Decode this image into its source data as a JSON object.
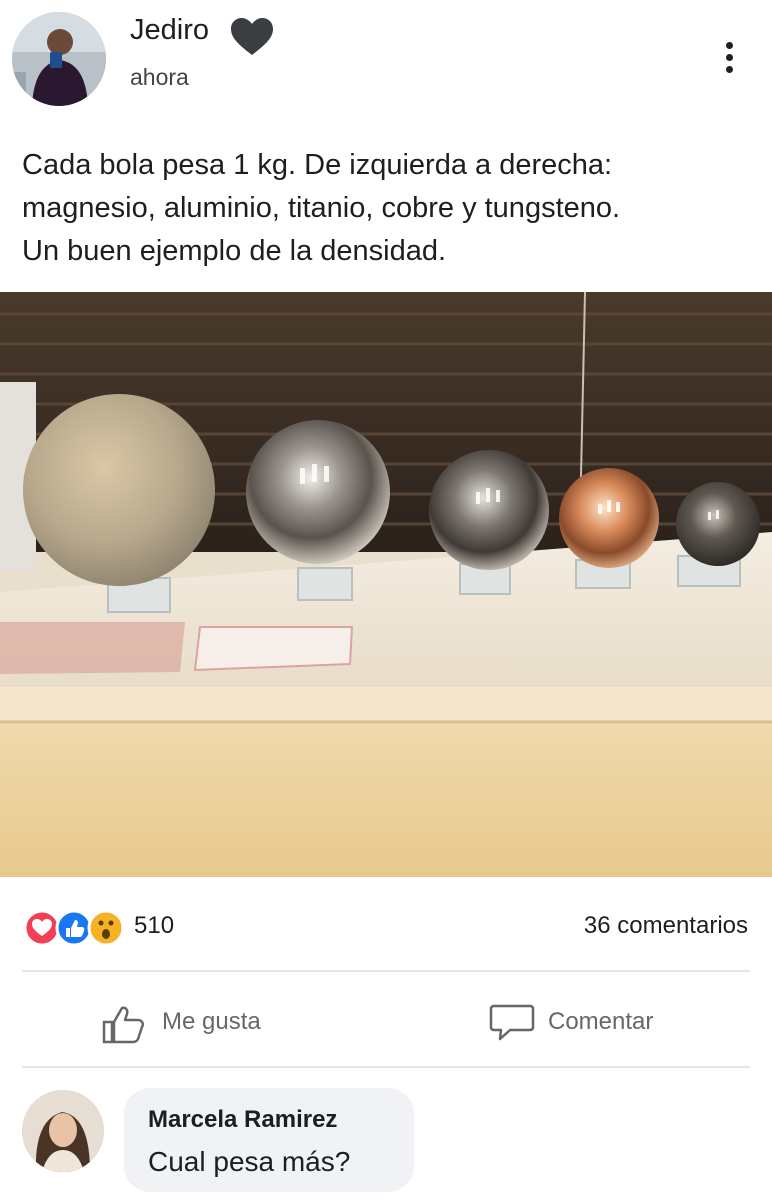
{
  "post": {
    "author": "Jediro",
    "time": "ahora",
    "text_lines": [
      "Cada bola pesa 1 kg. De izquierda a derecha:",
      "magnesio, aluminio, titanio, cobre y tungsteno.",
      "Un buen ejemplo de la densidad."
    ],
    "image_alt": "Cinco esferas metálicas de tamaño decreciente sobre soportes de cristal"
  },
  "stats": {
    "reactions": [
      "love",
      "like",
      "wow"
    ],
    "reaction_count": "510",
    "comments_label": "36 comentarios"
  },
  "actions": {
    "like_label": "Me gusta",
    "comment_label": "Comentar"
  },
  "comment": {
    "author": "Marcela Ramirez",
    "text": "Cual pesa más?"
  },
  "colors": {
    "text": "#1c1e21",
    "secondary": "#65676b",
    "divider": "#e4e6eb",
    "bubble": "#f0f2f5",
    "love": "#f33e58",
    "like": "#1877f2",
    "wow": "#f7b125"
  },
  "icons": [
    "heart-icon",
    "kebab-menu-icon",
    "like-icon",
    "comment-icon"
  ]
}
